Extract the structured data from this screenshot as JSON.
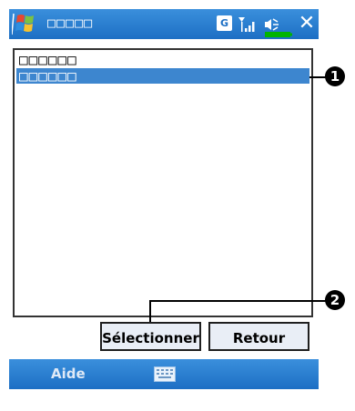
{
  "titlebar": {
    "title": "□□□□□",
    "status_g": "G"
  },
  "listbox": {
    "items": [
      {
        "label": "□□□□□□",
        "selected": false
      },
      {
        "label": "□□□□□□",
        "selected": true
      }
    ]
  },
  "callouts": {
    "one": "1",
    "two": "2"
  },
  "buttons": {
    "select_label": "Sélectionner",
    "back_label": "Retour"
  },
  "menubar": {
    "help_label": "Aide"
  },
  "colors": {
    "titlebar": "#1d6fc4",
    "selection": "#3d86cf",
    "button_bg": "#e9eef6"
  }
}
